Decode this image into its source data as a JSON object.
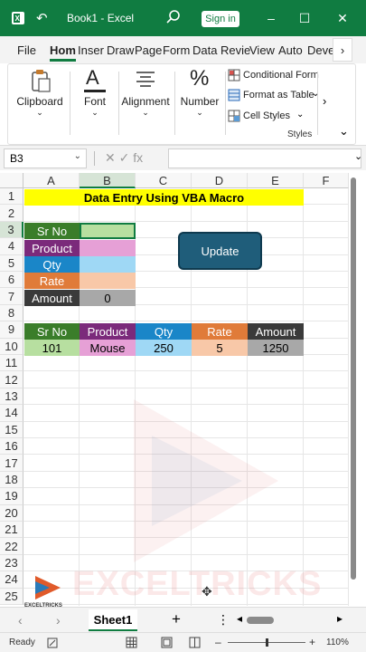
{
  "titlebar": {
    "title": "Book1  -  Excel",
    "signin_label": "Sign in",
    "minimize": "–",
    "maximize": "☐",
    "close": "✕",
    "undo": "↶",
    "chevron": "⌄"
  },
  "tabs": [
    "File",
    "Hom",
    "Inser",
    "Draw",
    "Page",
    "Form",
    "Data",
    "Revie",
    "View",
    "Auto",
    "Deve"
  ],
  "tabs_more": "›",
  "ribbon": {
    "clipboard": "Clipboard",
    "font": "Font",
    "alignment": "Alignment",
    "number": "Number",
    "conditional_formatting": "Conditional Form",
    "format_as_table": "Format as Table",
    "cell_styles": "Cell Styles",
    "styles_caption": "Styles",
    "number_symbol": "%",
    "font_symbol": "A",
    "expand": "›",
    "collapse": "⌄",
    "chevron": "⌄",
    "dropdown_arrow": "›"
  },
  "formula_bar": {
    "name_box": "B3",
    "fx": "✕  ✓  fx",
    "value": "",
    "name_box_dropdown": "⌄",
    "expand": "⌄"
  },
  "grid": {
    "columns": [
      "A",
      "B",
      "C",
      "D",
      "E",
      "F"
    ],
    "rows": [
      "1",
      "2",
      "3",
      "4",
      "5",
      "6",
      "7",
      "8",
      "9",
      "10",
      "11",
      "12",
      "13",
      "14",
      "15",
      "16",
      "17",
      "18",
      "19",
      "20",
      "21",
      "22",
      "23",
      "24",
      "25"
    ],
    "title": "Data Entry Using VBA Macro",
    "form_labels": [
      "Sr No",
      "Product",
      "Qty",
      "Rate",
      "Amount"
    ],
    "form_amount_value": "0",
    "table_headers": [
      "Sr No",
      "Product",
      "Qty",
      "Rate",
      "Amount"
    ],
    "table_row": [
      "101",
      "Mouse",
      "250",
      "5",
      "1250"
    ]
  },
  "update_button": "Update",
  "watermark": "EXCELTRICKS",
  "logo_text": "EXCELTRICKS",
  "sheetbar": {
    "sheet_name": "Sheet1",
    "add": "+",
    "menu": "⋮",
    "prev": "‹",
    "next": "›",
    "scroll_left": "◂",
    "scroll_right": "▸"
  },
  "statusbar": {
    "ready": "Ready",
    "zoom": "110%",
    "zoom_out": "–",
    "zoom_in": "+"
  },
  "colors": {
    "excel_green": "#107c41",
    "title_yellow": "#ffff00",
    "sr_no": "#3a7d2a",
    "product": "#7b2a7b",
    "qty": "#1a86c8",
    "rate": "#e07b39",
    "amount": "#3a3a3a",
    "button": "#1f5d7a"
  }
}
